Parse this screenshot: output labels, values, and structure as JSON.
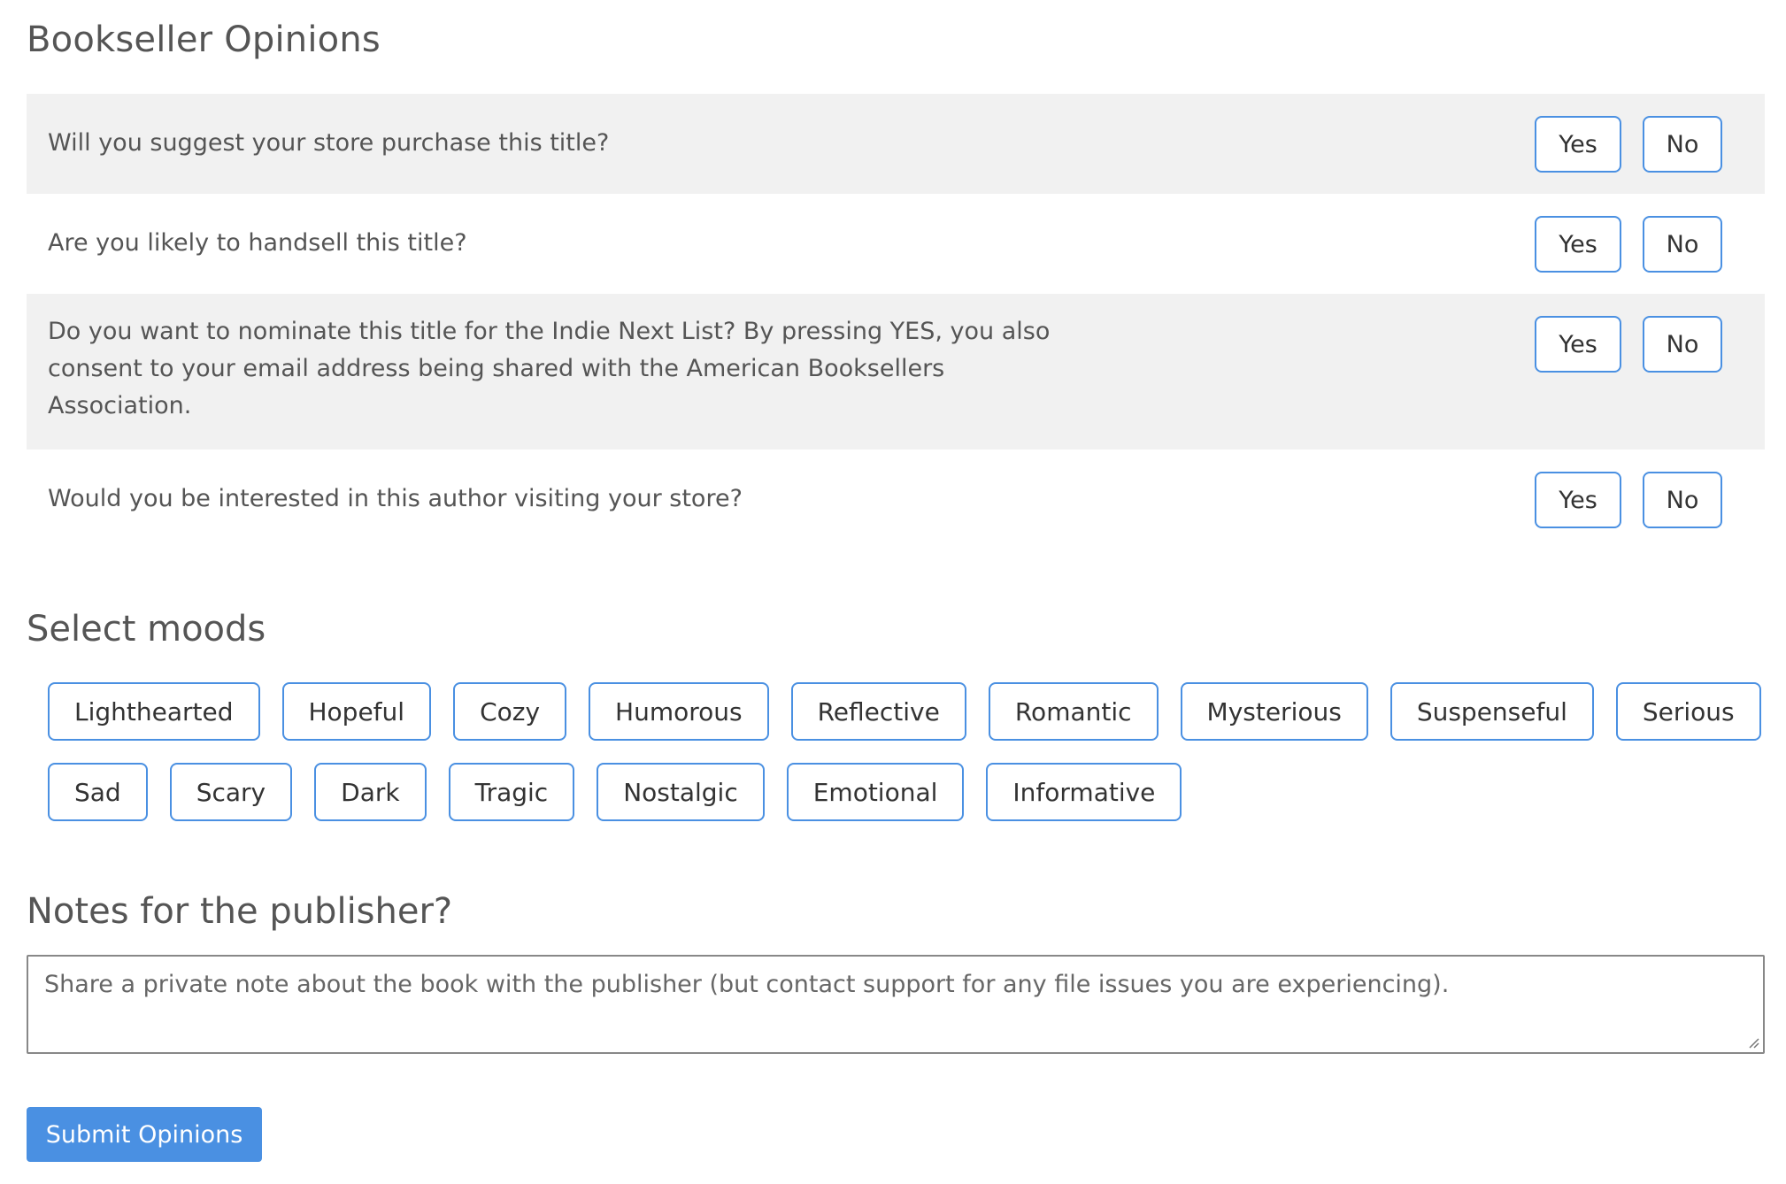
{
  "opinions": {
    "title": "Bookseller Opinions",
    "questions": [
      {
        "text": "Will you suggest your store purchase this title?",
        "yes": "Yes",
        "no": "No"
      },
      {
        "text": "Are you likely to handsell this title?",
        "yes": "Yes",
        "no": "No"
      },
      {
        "text": "Do you want to nominate this title for the Indie Next List? By pressing YES, you also consent to your email address being shared with the American Booksellers Association.",
        "yes": "Yes",
        "no": "No"
      },
      {
        "text": "Would you be interested in this author visiting your store?",
        "yes": "Yes",
        "no": "No"
      }
    ]
  },
  "moods": {
    "title": "Select moods",
    "items": [
      "Lighthearted",
      "Hopeful",
      "Cozy",
      "Humorous",
      "Reflective",
      "Romantic",
      "Mysterious",
      "Suspenseful",
      "Serious",
      "Sad",
      "Scary",
      "Dark",
      "Tragic",
      "Nostalgic",
      "Emotional",
      "Informative"
    ]
  },
  "notes": {
    "title": "Notes for the publisher?",
    "placeholder": "Share a private note about the book with the publisher (but contact support for any file issues you are experiencing)."
  },
  "submit": {
    "label": "Submit Opinions"
  },
  "colors": {
    "accent": "#4a90e2",
    "row_shade": "#f1f1f1",
    "text": "#555555"
  }
}
